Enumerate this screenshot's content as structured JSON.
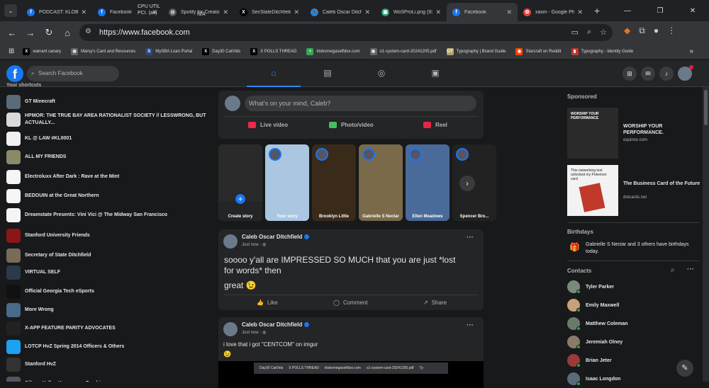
{
  "chrome": {
    "tabs": [
      {
        "title": "PODCAST: KLOB@...",
        "fav_color": "#1877f2",
        "fav_glyph": "f"
      },
      {
        "title": "Facebook",
        "fav_color": "#1877f2",
        "fav_glyph": "f"
      },
      {
        "title": "Spotify for Creators",
        "fav_color": "#555",
        "fav_glyph": "◎"
      },
      {
        "title": "SecStateDitchfield",
        "fav_color": "#000",
        "fav_glyph": "X"
      },
      {
        "title": "Caleb Oscar Ditchf...",
        "fav_color": "#1185fe",
        "fav_glyph": "🦋"
      },
      {
        "title": "WoSProLi.png (936...",
        "fav_color": "#22a06b",
        "fav_glyph": "▣"
      },
      {
        "title": "Facebook",
        "fav_color": "#1877f2",
        "fav_glyph": "f"
      },
      {
        "title": "xaxiri - Google Pho...",
        "fav_color": "#ea4335",
        "fav_glyph": "✿"
      }
    ],
    "tab_overlay_1": "CPU UTIL",
    "tab_overlay_2": "PCI. (av)",
    "tab_overlay_3": "N/A",
    "url": "https://www.facebook.com",
    "bookmarks": [
      {
        "label": "warrant canary",
        "color": "#000",
        "glyph": "X"
      },
      {
        "label": "Marsy's Card and Resources",
        "color": "#666",
        "glyph": "◍"
      },
      {
        "label": "MySBA Loan Portal",
        "color": "#2b4a7e",
        "glyph": "S"
      },
      {
        "label": "Day30 CatVids",
        "color": "#000",
        "glyph": "X"
      },
      {
        "label": "X POLLS THREAD",
        "color": "#000",
        "glyph": "X"
      },
      {
        "label": "klobsmegaselfdox.com",
        "color": "#34a853",
        "glyph": "+"
      },
      {
        "label": "o1-system-card-20241205.pdf",
        "color": "#666",
        "glyph": "◍"
      },
      {
        "label": "Typography | Brand Guide",
        "color": "#b3a369",
        "glyph": "GT"
      },
      {
        "label": "Starcraft on Reddit",
        "color": "#ff4500",
        "glyph": "◉"
      },
      {
        "label": "Typography - Identity Guide",
        "color": "#c0392b",
        "glyph": "▮"
      }
    ]
  },
  "fb": {
    "search_placeholder": "Search Facebook",
    "shortcuts_title": "Your shortcuts",
    "shortcuts": [
      {
        "label": "GT Minecraft",
        "color": "#5a6b7a"
      },
      {
        "label": "HPMOR: THE TRUE BAY AREA RATIONALIST SOCIETY // LESSWRONG, BUT ACTUALLY...",
        "color": "#d9d9d9"
      },
      {
        "label": "KL @ LAW #KL0001",
        "color": "#f0f0f0"
      },
      {
        "label": "ALL MY FRIENDS",
        "color": "#8a8a6a"
      },
      {
        "label": "Electroluxx After Dark : Rave at the Mint",
        "color": "#f5f5f5"
      },
      {
        "label": "BEDOUIN at the Great Northern",
        "color": "#f5f5f5"
      },
      {
        "label": "Dreamstate Presents: Vini Vici @ The Midway San Francisco",
        "color": "#f5f5f5"
      },
      {
        "label": "Stanford University Friends",
        "color": "#8c1515"
      },
      {
        "label": "Secretary of State Ditchfield",
        "color": "#7a6a5a"
      },
      {
        "label": "VIRTUAL SELF",
        "color": "#2a3a4a"
      },
      {
        "label": "Official Georgia Tech eSports",
        "color": "#111"
      },
      {
        "label": "More Wrong",
        "color": "#4a6a8a"
      },
      {
        "label": "X-APP FEATURE PARITY ADVOCATES",
        "color": "#222"
      },
      {
        "label": "LOTCP HvZ Spring 2014 Officers & Others",
        "color": "#1da1f2"
      },
      {
        "label": "Stanford HvZ",
        "color": "#333"
      },
      {
        "label": "Silicon Valley Humans vs Zombies",
        "color": "#556"
      }
    ],
    "composer": {
      "placeholder": "What's on your mind, Caleb?",
      "live": "Live video",
      "photo": "Photo/video",
      "reel": "Reel"
    },
    "stories": [
      {
        "label": "Create story",
        "color": "#2a2a2a"
      },
      {
        "label": "Your story",
        "color": "#aac6e0"
      },
      {
        "label": "Brooklyn Little",
        "color": "#3a2a1a"
      },
      {
        "label": "Gabrielle S Nectar",
        "color": "#7a6a4a"
      },
      {
        "label": "Ellen Meadows",
        "color": "#4a6a9a"
      },
      {
        "label": "Spencer Bro...",
        "color": "#222"
      }
    ],
    "posts": [
      {
        "author": "Caleb Oscar Ditchfield",
        "meta": "Just now · ◍",
        "line1": "soooo y'all are IMPRESSED SO MUCH that you are just *lost",
        "line2": "for words* then",
        "line3": "great 😉",
        "like": "Like",
        "comment": "Comment",
        "share": "Share"
      },
      {
        "author": "Caleb Oscar Ditchfield",
        "meta": "Just now · ◍",
        "text": "i love that i got \"CENTCOM\" on imgur",
        "emoji": "😉",
        "embed_tabs": [
          "Day30 CatVids",
          "X POLLS THREAD",
          "klobsmegaselfdox.com",
          "o1-system-card-20241205.pdf",
          "Ty"
        ]
      }
    ],
    "sponsored": {
      "title": "Sponsored",
      "ads": [
        {
          "title": "WORSHIP YOUR PERFORMANCE.",
          "url": "equinox.com",
          "thumb": "WORSHIP YOUR PERFORMANCE"
        },
        {
          "title": "The Business Card of the Future",
          "url": "dotcards.net",
          "thumb": "This networking tool unlocked my Pokemon card"
        }
      ]
    },
    "birthdays": {
      "title": "Birthdays",
      "text": "Gabrielle S Nectar and 3 others have birthdays today."
    },
    "contacts": {
      "title": "Contacts",
      "people": [
        {
          "name": "Tyler Parker",
          "color": "#7a8a7a"
        },
        {
          "name": "Emily Maxwell",
          "color": "#c9a07a"
        },
        {
          "name": "Matthew Coleman",
          "color": "#6a7a6a"
        },
        {
          "name": "Jeremiah Olney",
          "color": "#8a7a6a"
        },
        {
          "name": "Brian Jeter",
          "color": "#9a3a3a"
        },
        {
          "name": "Isaac Longdon",
          "color": "#5a6a7a"
        }
      ]
    }
  }
}
